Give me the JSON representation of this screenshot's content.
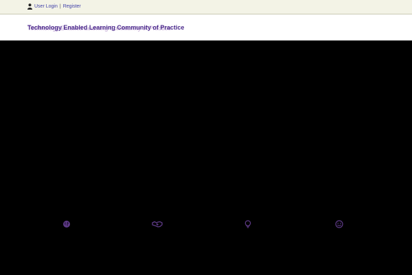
{
  "topbar": {
    "user_icon": "user-icon",
    "login_label": "User Login",
    "separator": "|",
    "register_label": "Register"
  },
  "header": {
    "site_title": "Technology Enabled Learning Community of Practice"
  },
  "features": [
    {
      "icon": "globe-icon"
    },
    {
      "icon": "handshake-icon"
    },
    {
      "icon": "lightbulb-icon"
    },
    {
      "icon": "smiley-icon"
    }
  ],
  "colors": {
    "topbar_bg": "#f3f3e6",
    "link": "#3f3fa8",
    "title": "#4b2a8c",
    "icon": "#5e3a87",
    "hero_bg": "#000000"
  }
}
